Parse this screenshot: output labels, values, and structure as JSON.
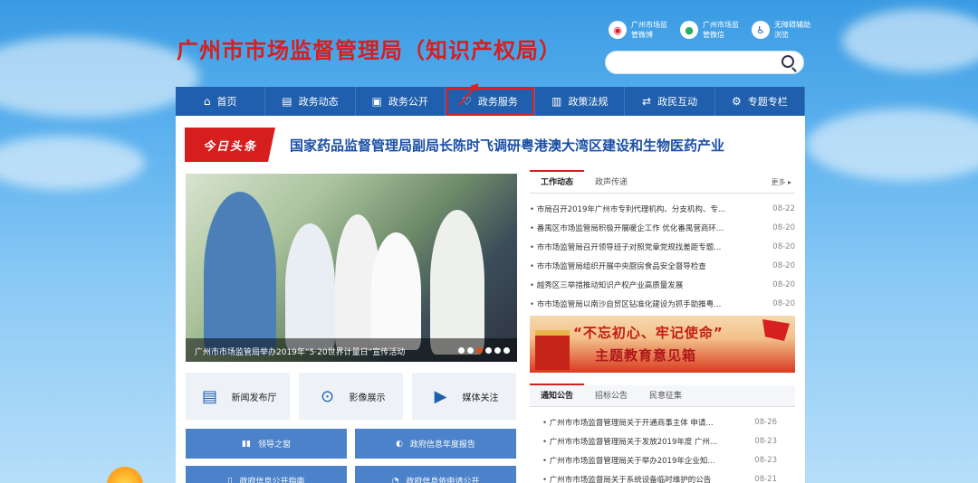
{
  "header": {
    "title": "广州市市场监督管理局（知识产权局）",
    "quick_links": [
      {
        "icon": "weibo-icon",
        "label": "广州市场监管微博"
      },
      {
        "icon": "wechat-icon",
        "label": "广州市场监管微信"
      },
      {
        "icon": "accessibility-icon",
        "label": "无障碍辅助浏览"
      }
    ],
    "search_placeholder": ""
  },
  "nav": {
    "items": [
      {
        "icon": "home-icon",
        "label": "首页"
      },
      {
        "icon": "news-icon",
        "label": "政务动态"
      },
      {
        "icon": "open-icon",
        "label": "政务公开"
      },
      {
        "icon": "service-icon",
        "label": "政务服务",
        "highlighted": true
      },
      {
        "icon": "policy-icon",
        "label": "政策法规"
      },
      {
        "icon": "interact-icon",
        "label": "政民互动"
      },
      {
        "icon": "topic-icon",
        "label": "专题专栏"
      }
    ]
  },
  "headline": {
    "tag": "今日头条",
    "text": "国家药品监督管理局副局长陈时飞调研粤港澳大湾区建设和生物医药产业"
  },
  "slideshow": {
    "caption": "广州市市场监管局举办2019年“5·20世界计量日”宣传活动",
    "dots": 6,
    "active_dot": 3
  },
  "tiles": [
    {
      "icon": "press-icon",
      "label": "新闻发布厅"
    },
    {
      "icon": "play-icon",
      "label": "影像展示"
    },
    {
      "icon": "clapper-icon",
      "label": "媒体关注"
    }
  ],
  "blue_buttons": [
    {
      "icon": "book-icon",
      "label": "领导之窗"
    },
    {
      "icon": "compass-icon",
      "label": "政府信息年度报告"
    },
    {
      "icon": "doc-icon",
      "label": "政府信息公开指南"
    },
    {
      "icon": "person-icon",
      "label": "政府信息依申请公开"
    }
  ],
  "news": {
    "tabs": [
      "工作动态",
      "政声传递"
    ],
    "more": "更多 ▸",
    "items": [
      {
        "title": "市局召开2019年广州市专利代理机构、分支机构、专...",
        "date": "08-22"
      },
      {
        "title": "番禺区市场监管局积极开展暖企工作 优化番禺营商环...",
        "date": "08-20"
      },
      {
        "title": "市市场监管局召开领导班子对照党章党规找差距专题...",
        "date": "08-20"
      },
      {
        "title": "市市场监管局组织开展中央厨房食品安全督导检查",
        "date": "08-20"
      },
      {
        "title": "越秀区三举措推动知识产权产业高质量发展",
        "date": "08-20"
      },
      {
        "title": "市市场监管局以南沙自贸区钻准化建设为抓手助推粤...",
        "date": "08-20"
      }
    ]
  },
  "banner": {
    "line1": "“不忘初心、牢记使命”",
    "line2": "主题教育意见箱"
  },
  "notice": {
    "tabs": [
      "通知公告",
      "招标公告",
      "民意征集"
    ],
    "items": [
      {
        "title": "广州市市场监督管理局关于开通商事主体 申请...",
        "date": "08-26"
      },
      {
        "title": "广州市市场监督管理局关于发放2019年度 广州...",
        "date": "08-23"
      },
      {
        "title": "广州市市场监督管理局关于举办2019年企业知...",
        "date": "08-23"
      },
      {
        "title": "广州市市场监督局关于系统设备临时维护的公告",
        "date": "08-21"
      }
    ]
  }
}
